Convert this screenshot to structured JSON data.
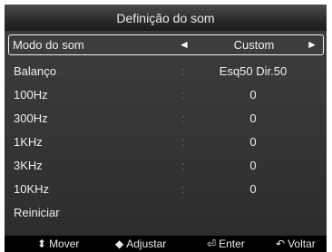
{
  "title": "Definição do som",
  "mode_row": {
    "label": "Modo do som",
    "value": "Custom",
    "arrow_left": "◄",
    "arrow_right": "►"
  },
  "rows": [
    {
      "label": "Balanço",
      "colon": ":",
      "value": "Esq50 Dir.50"
    },
    {
      "label": "100Hz",
      "colon": ":",
      "value": "0"
    },
    {
      "label": "300Hz",
      "colon": ":",
      "value": "0"
    },
    {
      "label": "1KHz",
      "colon": ":",
      "value": "0"
    },
    {
      "label": "3KHz",
      "colon": ":",
      "value": "0"
    },
    {
      "label": "10KHz",
      "colon": ":",
      "value": "0"
    },
    {
      "label": "Reiniciar"
    }
  ],
  "footer": {
    "move": {
      "icon": "up-down-arrows-icon",
      "glyph": "⬍",
      "label": "Mover"
    },
    "adjust": {
      "icon": "left-right-arrows-icon",
      "glyph": "◆",
      "label": "Adjustar"
    },
    "enter": {
      "icon": "enter-icon",
      "glyph": "⏎",
      "label": "Enter"
    },
    "back": {
      "icon": "return-icon",
      "glyph": "↶",
      "label": "Voltar"
    }
  }
}
